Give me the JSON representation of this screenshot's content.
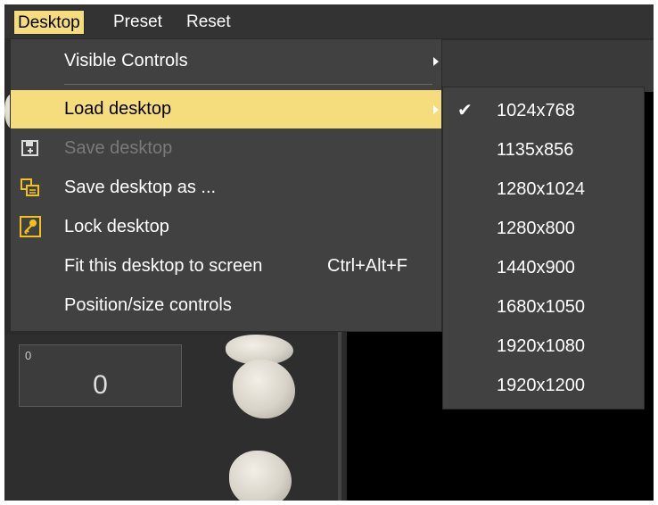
{
  "menubar": {
    "items": [
      "Desktop",
      "Preset",
      "Reset"
    ]
  },
  "desktop_menu": {
    "visible_controls": "Visible Controls",
    "load_desktop": "Load desktop",
    "save_desktop": "Save desktop",
    "save_desktop_as": "Save desktop as ...",
    "lock_desktop": "Lock desktop",
    "fit_desktop": "Fit this desktop to screen",
    "fit_shortcut": "Ctrl+Alt+F",
    "position_size": "Position/size controls"
  },
  "load_submenu": {
    "selected": "1024x768",
    "items": [
      "1024x768",
      "1135x856",
      "1280x1024",
      "1280x800",
      "1440x900",
      "1680x1050",
      "1920x1080",
      "1920x1200"
    ]
  },
  "widget": {
    "small": "0",
    "big": "0"
  },
  "colors": {
    "highlight": "#f5dc7c",
    "menu_bg": "#414141",
    "app_bg": "#2b2b2b"
  },
  "icons": [
    "save-icon",
    "save-as-icon",
    "lock-key-icon",
    "checkmark-icon",
    "submenu-arrow-icon"
  ]
}
